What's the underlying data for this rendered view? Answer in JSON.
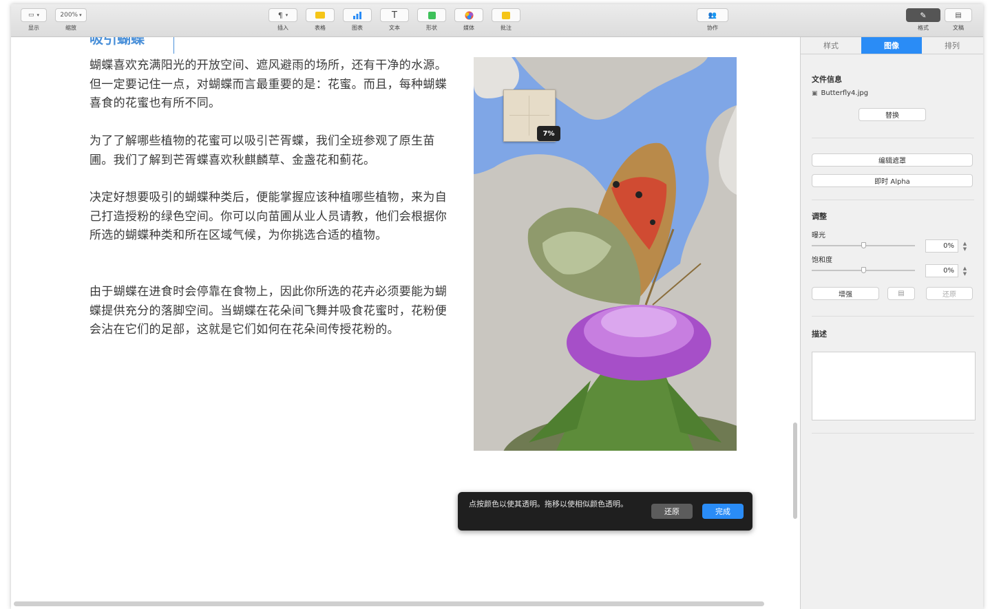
{
  "toolbar": {
    "view_label": "显示",
    "zoom_value": "200%",
    "zoom_label": "缩放",
    "insert_label": "插入",
    "table_label": "表格",
    "chart_label": "图表",
    "text_label": "文本",
    "shape_label": "形状",
    "media_label": "媒体",
    "comment_label": "批注",
    "collaborate_label": "协作",
    "format_label": "格式",
    "document_label": "文稿"
  },
  "document": {
    "heading": "吸引蝴蝶",
    "paragraphs": [
      "蝴蝶喜欢充满阳光的开放空间、遮风避雨的场所，还有干净的水源。但一定要记住一点，对蝴蝶而言最重要的是：花蜜。而且，每种蝴蝶喜食的花蜜也有所不同。",
      "为了了解哪些植物的花蜜可以吸引芒胥蝶，我们全班参观了原生苗圃。我们了解到芒胥蝶喜欢秋麒麟草、金盏花和蓟花。",
      "决定好想要吸引的蝴蝶种类后，便能掌握应该种植哪些植物，来为自己打造授粉的绿色空间。你可以向苗圃从业人员请教，他们会根据你所选的蝴蝶种类和所在区域气候，为你挑选合适的植物。",
      "由于蝴蝶在进食时会停靠在食物上，因此你所选的花卉必须要能为蝴蝶提供充分的落脚空间。当蝴蝶在花朵间飞舞并吸食花蜜时，花粉便会沾在它们的足部，这就是它们如何在花朵间传授花粉的。"
    ],
    "alpha_percent": "7%"
  },
  "hud": {
    "message": "点按颜色以使其透明。拖移以使相似颜色透明。",
    "reset_label": "还原",
    "done_label": "完成"
  },
  "inspector": {
    "tabs": [
      "样式",
      "图像",
      "排列"
    ],
    "active_tab": 1,
    "file_info_title": "文件信息",
    "file_name": "Butterfly4.jpg",
    "replace_label": "替换",
    "edit_mask_label": "编辑遮罩",
    "instant_alpha_label": "即时 Alpha",
    "adjust_title": "调整",
    "exposure_label": "曝光",
    "exposure_value": "0%",
    "exposure_level": 0.5,
    "saturation_label": "饱和度",
    "saturation_value": "0%",
    "saturation_level": 0.5,
    "enhance_label": "增强",
    "reset_label": "还原",
    "description_title": "描述"
  },
  "colors": {
    "accent": "#2a8cf6",
    "heading": "#4a90d9",
    "hud_bg": "#1f1f1f"
  }
}
